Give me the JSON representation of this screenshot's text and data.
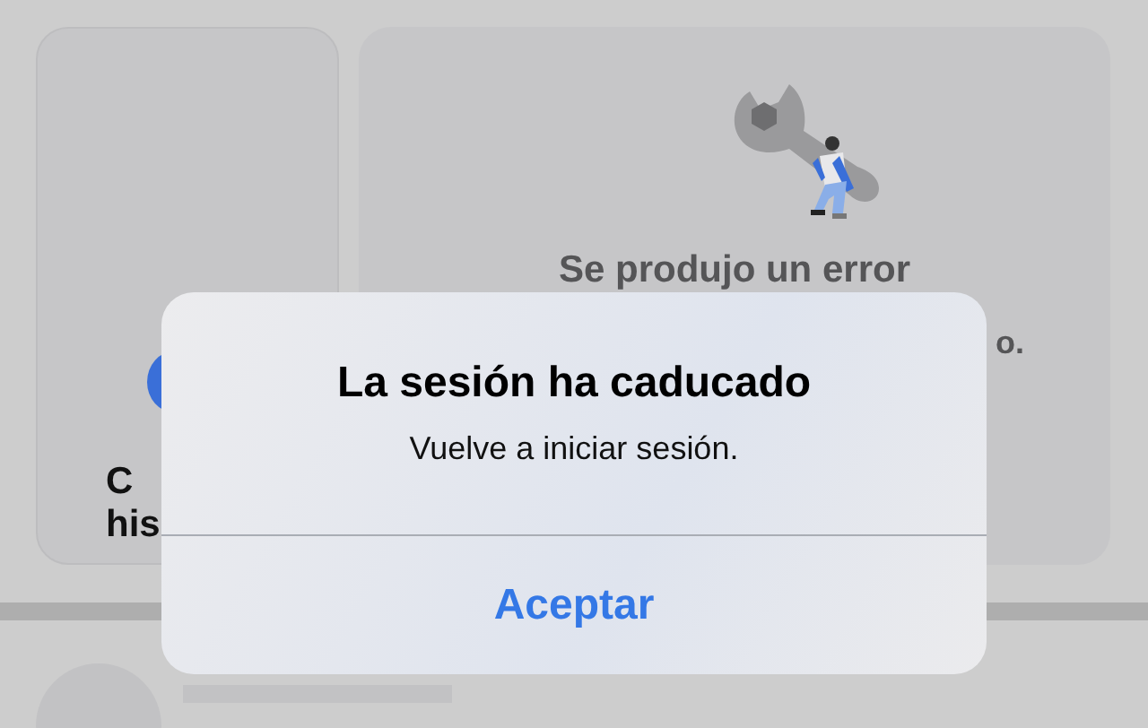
{
  "background": {
    "left_card": {
      "lines": [
        "C",
        "his"
      ]
    },
    "right_card": {
      "title": "Se produjo un error",
      "line_2": "o."
    }
  },
  "alert": {
    "title": "La sesión ha caducado",
    "message": "Vuelve a iniciar sesión.",
    "buttons": [
      {
        "label": "Aceptar",
        "kind": "primary"
      }
    ]
  }
}
